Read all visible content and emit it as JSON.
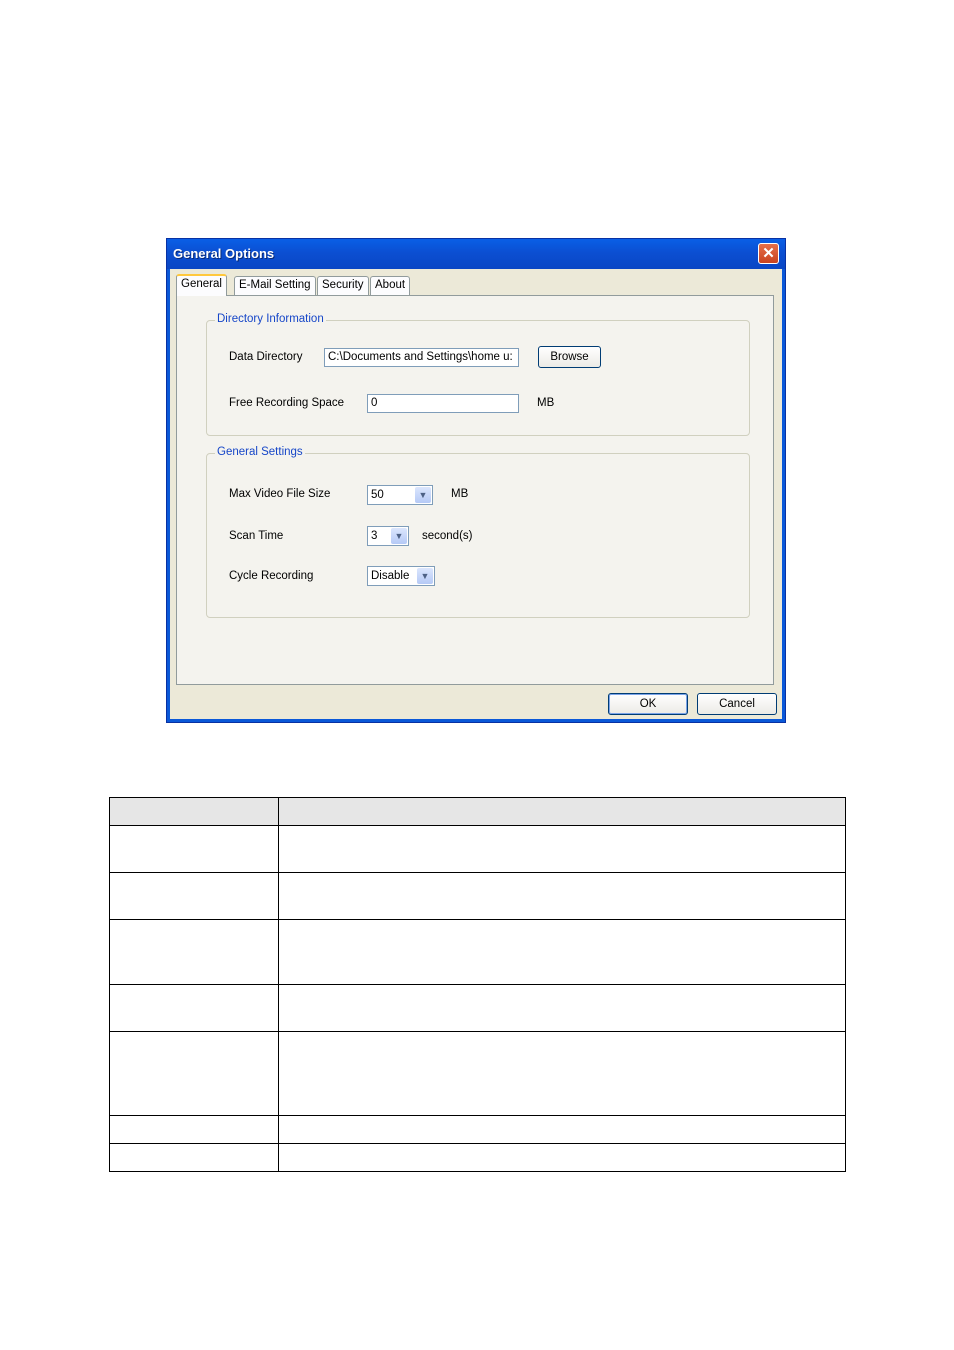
{
  "dialog": {
    "title": "General Options",
    "close_label": "✕",
    "tabs": [
      {
        "label": "General",
        "active": true
      },
      {
        "label": "E-Mail Setting",
        "active": false
      },
      {
        "label": "Security",
        "active": false
      },
      {
        "label": "About",
        "active": false
      }
    ],
    "directory_group": {
      "title": "Directory Information",
      "data_directory_label": "Data Directory",
      "data_directory_value": "C:\\Documents and Settings\\home u:",
      "browse_label": "Browse",
      "free_space_label": "Free Recording Space",
      "free_space_value": "0",
      "free_space_unit": "MB"
    },
    "settings_group": {
      "title": "General Settings",
      "max_video_label": "Max Video File Size",
      "max_video_value": "50",
      "max_video_unit": "MB",
      "scan_time_label": "Scan Time",
      "scan_time_value": "3",
      "scan_time_unit": "second(s)",
      "cycle_label": "Cycle Recording",
      "cycle_value": "Disable"
    },
    "ok_label": "OK",
    "cancel_label": "Cancel"
  },
  "table": {
    "row_count": 7
  }
}
